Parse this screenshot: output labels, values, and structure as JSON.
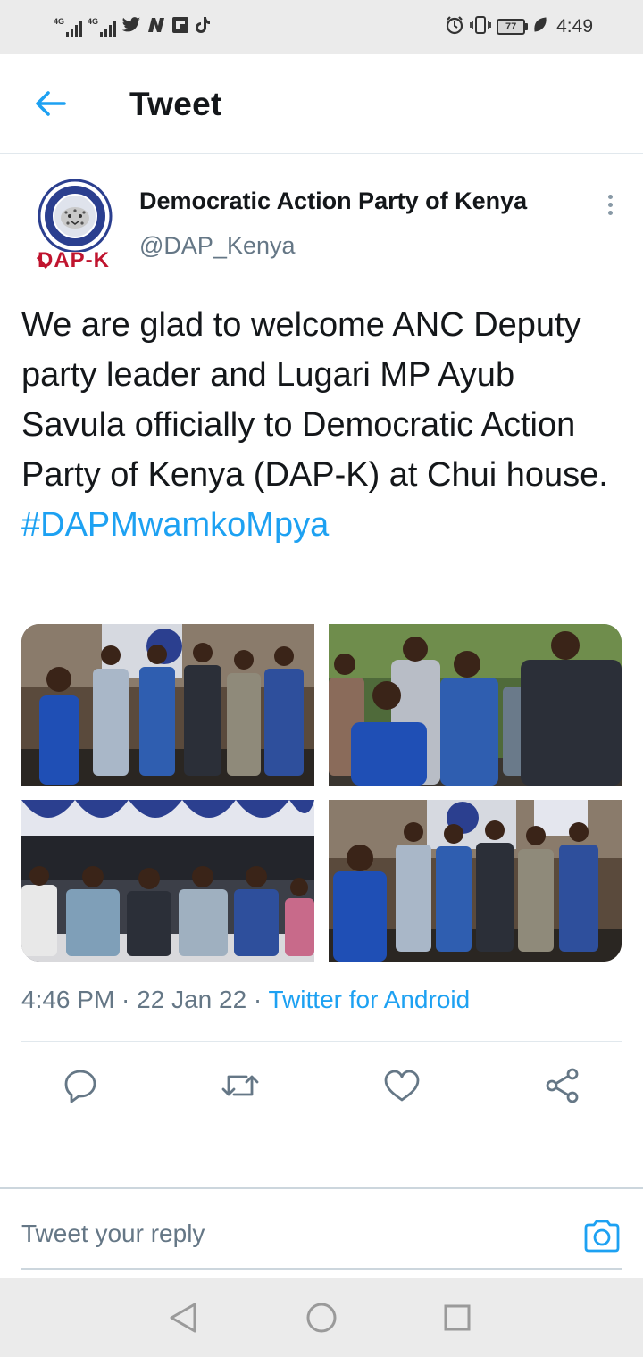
{
  "status_bar": {
    "network_1": "4G",
    "network_2": "4G",
    "battery_level": "77",
    "time": "4:49",
    "notification_icons": [
      "twitter-icon",
      "n-icon",
      "flipboard-icon",
      "tiktok-icon"
    ],
    "system_icons": [
      "alarm-icon",
      "vibrate-icon",
      "battery-icon",
      "leaf-icon"
    ]
  },
  "header": {
    "title": "Tweet"
  },
  "tweet": {
    "author": {
      "display_name": "Democratic Action Party of Kenya",
      "handle": "@DAP_Kenya",
      "avatar_logo_text": "DAP-K"
    },
    "text": "We are glad to welcome ANC Deputy party leader and Lugari MP Ayub Savula officially to Democratic Action Party of Kenya (DAP-K) at Chui house.",
    "hashtag": "#DAPMwamkoMpya",
    "timestamp": "4:46 PM · 22 Jan 22 · ",
    "source": "Twitter for Android",
    "photo_count": 4
  },
  "actions": [
    "reply-icon",
    "retweet-icon",
    "like-icon",
    "share-icon"
  ],
  "reply": {
    "placeholder": "Tweet your reply"
  },
  "colors": {
    "accent": "#1da1f2",
    "secondary_text": "#657786",
    "primary_text": "#14171a"
  }
}
